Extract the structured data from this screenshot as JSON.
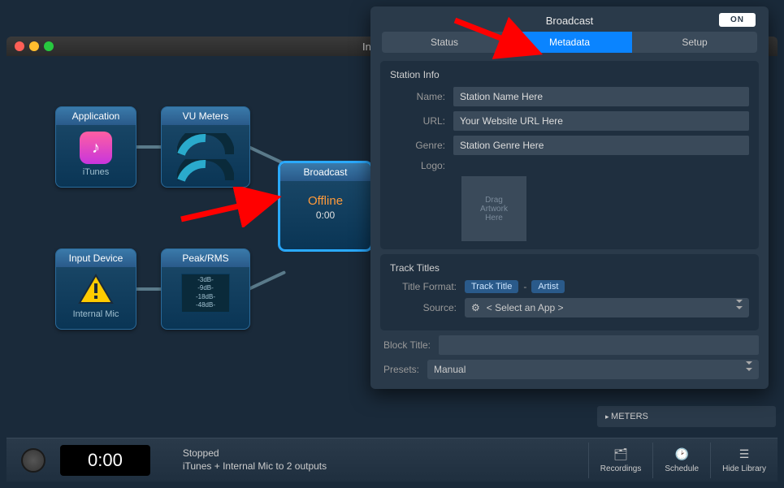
{
  "window": {
    "title": "In"
  },
  "nodes": {
    "application": {
      "header": "Application",
      "label": "iTunes"
    },
    "vu": {
      "header": "VU Meters"
    },
    "broadcast": {
      "header": "Broadcast",
      "status": "Offline",
      "time": "0:00"
    },
    "inputDevice": {
      "header": "Input Device",
      "label": "Internal Mic"
    },
    "peak": {
      "header": "Peak/RMS",
      "lines": [
        "-3dB-",
        "-9dB-",
        "-18dB-",
        "-48dB-"
      ]
    }
  },
  "panel": {
    "title": "Broadcast",
    "toggle": "ON",
    "tabs": {
      "status": "Status",
      "metadata": "Metadata",
      "setup": "Setup",
      "active": "metadata"
    },
    "stationInfo": {
      "heading": "Station Info",
      "nameLabel": "Name:",
      "nameValue": "Station Name Here",
      "urlLabel": "URL:",
      "urlValue": "Your Website URL Here",
      "genreLabel": "Genre:",
      "genreValue": "Station Genre Here",
      "logoLabel": "Logo:",
      "logoPlaceholder": "Drag\nArtwork\nHere"
    },
    "trackTitles": {
      "heading": "Track Titles",
      "formatLabel": "Title Format:",
      "tagTitle": "Track Title",
      "tagArtist": "Artist",
      "sourceLabel": "Source:",
      "sourceValue": "< Select an App >"
    },
    "blockTitleLabel": "Block Title:",
    "presetsLabel": "Presets:",
    "presetsValue": "Manual"
  },
  "meters": {
    "header": "METERS"
  },
  "transport": {
    "time": "0:00",
    "statusLine1": "Stopped",
    "statusLine2": "iTunes + Internal Mic to 2 outputs",
    "buttons": {
      "recordings": "Recordings",
      "schedule": "Schedule",
      "hideLibrary": "Hide Library"
    }
  }
}
